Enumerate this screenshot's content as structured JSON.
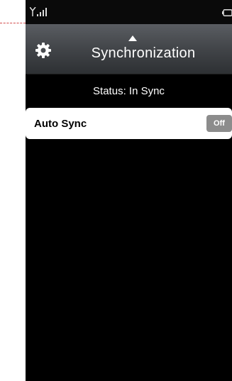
{
  "header": {
    "title": "Synchronization"
  },
  "status": {
    "text": "Status: In Sync"
  },
  "settings": {
    "auto_sync_label": "Auto Sync",
    "auto_sync_toggle": "Off"
  },
  "icons": {
    "signal": "signal-icon",
    "battery": "battery-icon",
    "settings": "gear-icon",
    "expand": "caret-up-icon"
  }
}
